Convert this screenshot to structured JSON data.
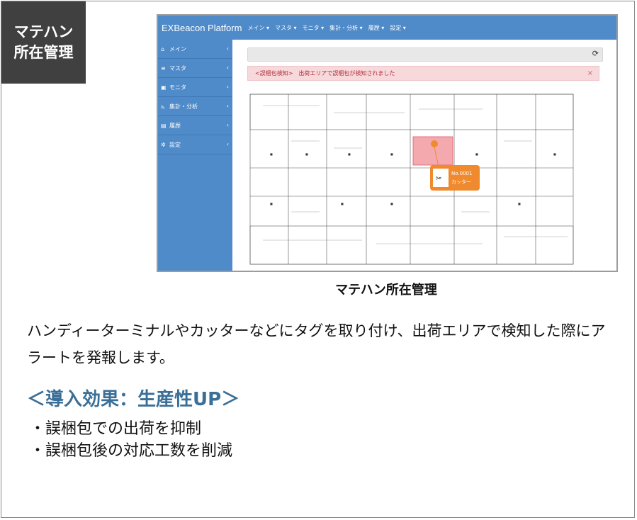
{
  "corner_tag": {
    "line1": "マテハン",
    "line2": "所在管理"
  },
  "screenshot": {
    "brand": "EXBeacon Platform",
    "topnav": [
      "メイン ▾",
      "マスタ ▾",
      "モニタ ▾",
      "集計・分析 ▾",
      "履歴 ▾",
      "設定 ▾"
    ],
    "sidebar": [
      {
        "icon": "home-icon",
        "label": "メイン"
      },
      {
        "icon": "database-icon",
        "label": "マスタ"
      },
      {
        "icon": "monitor-icon",
        "label": "モニタ"
      },
      {
        "icon": "chart-icon",
        "label": "集計・分析"
      },
      {
        "icon": "document-icon",
        "label": "履歴"
      },
      {
        "icon": "gear-icon",
        "label": "設定"
      }
    ],
    "alert_text": "<誤梱包検知>　出荷エリアで誤梱包が検知されました",
    "alert_close": "×",
    "refresh_glyph": "⟳",
    "tag_popup": {
      "id": "No.0001",
      "name": "カッター"
    }
  },
  "caption": "マテハン所在管理",
  "description": "ハンディーターミナルやカッターなどにタグを取り付け、出荷エリアで検知した際にアラートを発報します。",
  "effect_title": "＜導入効果：生産性UP＞",
  "bullets": [
    "・誤梱包での出荷を抑制",
    "・誤梱包後の対応工数を削減"
  ]
}
